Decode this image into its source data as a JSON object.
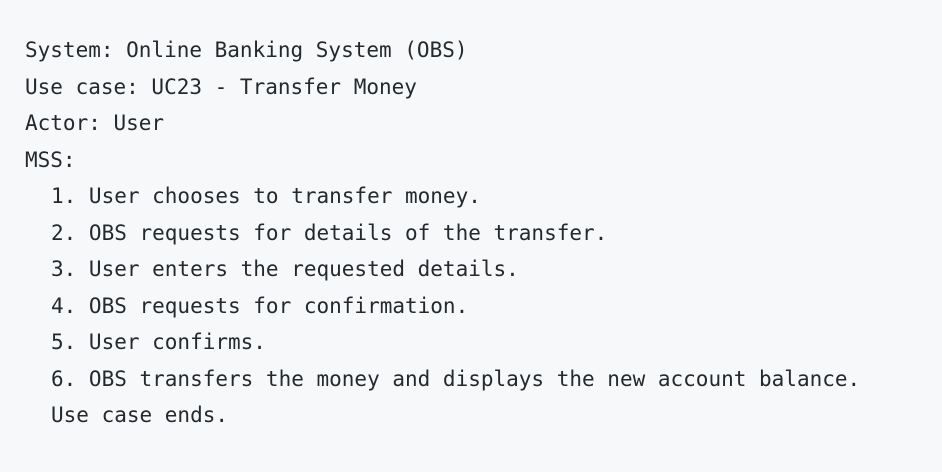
{
  "header": {
    "system": "System: Online Banking System (OBS)",
    "use_case": "Use case: UC23 - Transfer Money",
    "actor": "Actor: User",
    "mss_label": "MSS:"
  },
  "steps": [
    "1. User chooses to transfer money.",
    "2. OBS requests for details of the transfer.",
    "3. User enters the requested details.",
    "4. OBS requests for confirmation.",
    "5. User confirms.",
    "6. OBS transfers the money and displays the new account balance."
  ],
  "footer": {
    "end_text": "Use case ends."
  }
}
